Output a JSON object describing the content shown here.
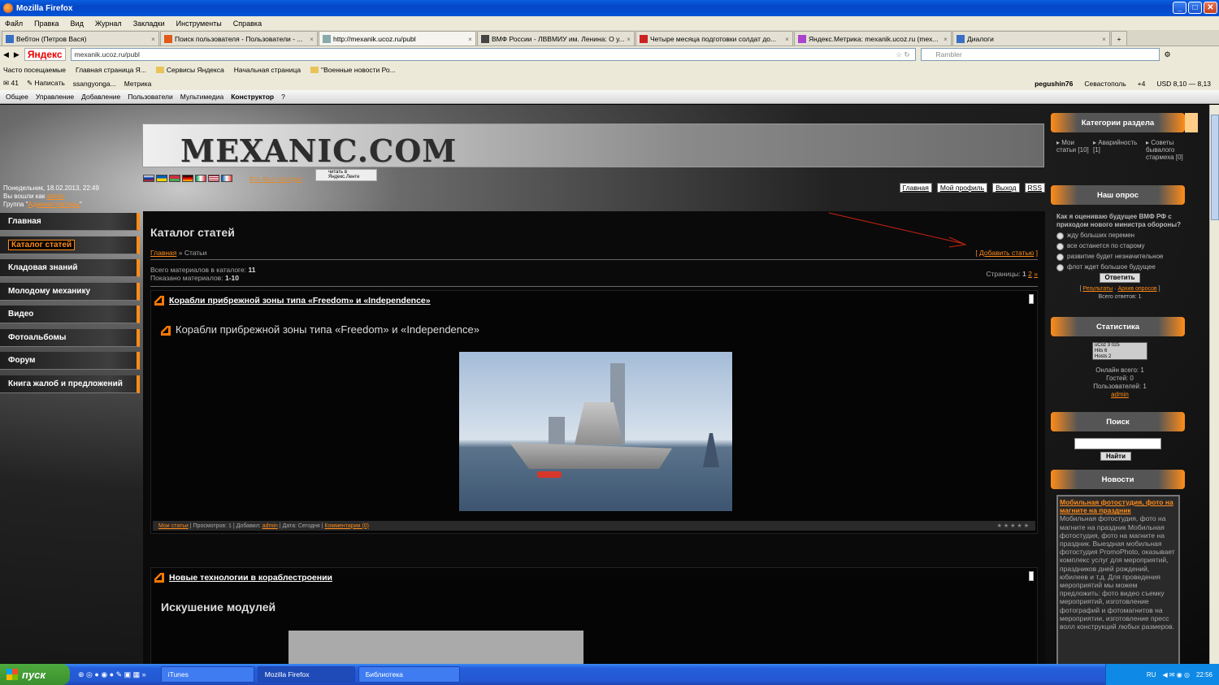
{
  "window": {
    "title": "Mozilla Firefox"
  },
  "menu": [
    "Файл",
    "Правка",
    "Вид",
    "Журнал",
    "Закладки",
    "Инструменты",
    "Справка"
  ],
  "tabs": [
    {
      "label": "Вебтон (Петров Вася)",
      "active": false
    },
    {
      "label": "Поиск пользователя - Пользователи - ...",
      "active": false
    },
    {
      "label": "http://mexanik.ucoz.ru/publ",
      "active": true
    },
    {
      "label": "ВМФ России - ЛВВМИУ им. Ленина: О у...",
      "active": false
    },
    {
      "label": "Четыре месяца подготовки солдат до...",
      "active": false
    },
    {
      "label": "Яндекс.Метрика: mexanik.ucoz.ru (mex...",
      "active": false
    },
    {
      "label": "Диалоги",
      "active": false
    }
  ],
  "nav": {
    "yandex": "Яндекс",
    "url": "mexanik.ucoz.ru/publ",
    "search_placeholder": "Rambler"
  },
  "bookmarks": [
    "Часто посещаемые",
    "Главная страница Я...",
    "Сервисы Яндекса",
    "Начальная страница",
    "\"Военные новости Ро..."
  ],
  "yabar": {
    "mail": "41",
    "write": "Написать",
    "user_short": "ssangyonga...",
    "metrika": "Метрика",
    "username": "pegushin76",
    "city": "Севастополь",
    "temp": "+4",
    "usd": "USD 8,10 — 8,13"
  },
  "ucoz_menu": [
    "Общее",
    "Управление",
    "Добавление",
    "Пользователи",
    "Мультимедиа",
    "Конструктор",
    "?"
  ],
  "site": {
    "logo": "MEXANIC.COM",
    "kto": "Кто был сегодня",
    "yalenta": "читать в Яндекс.Ленте",
    "date": "Понедельник, 18.02.2013, 22:49",
    "logged_as": "Вы вошли как",
    "user": "admin",
    "group_label": "Группа",
    "group": "Администраторы",
    "toplinks": [
      "Главная",
      "Мой профиль",
      "Выход",
      "RSS"
    ],
    "left_menu": [
      "Главная",
      "Каталог статей",
      "Кладовая знаний",
      "Молодому механику",
      "Видео",
      "Фотоальбомы",
      "Форум",
      "Книга жалоб и предложений"
    ]
  },
  "content": {
    "title": "Каталог статей",
    "crumb_home": "Главная",
    "crumb_sep": " » ",
    "crumb_current": "Статьи",
    "add": "Добавить статью",
    "total_label": "Всего материалов в каталоге:",
    "total": "11",
    "shown_label": "Показано материалов:",
    "shown": "1-10",
    "pages_label": "Страницы:",
    "pages": [
      "1",
      "2",
      "»"
    ],
    "entries": [
      {
        "title": "Корабли прибрежной зоны типа «Freedom» и «Independence»",
        "big": "Корабли прибрежной зоны типа «Freedom» и «Independence»",
        "footer_cat": "Мои статьи",
        "footer_views": "Просмотров: 1",
        "footer_added": "Добавил:",
        "footer_user": "admin",
        "footer_date": "Дата: Сегодня",
        "footer_comments": "Комментарии (0)"
      },
      {
        "title": "Новые технологии в кораблестроении",
        "big": "Искушение модулей"
      }
    ]
  },
  "sidebar": {
    "categories_title": "Категории раздела",
    "categories": [
      {
        "name": "Мои статьи",
        "count": "[10]"
      },
      {
        "name": "Аварийность",
        "count": "[1]"
      },
      {
        "name": "Советы бывалого стармеха",
        "count": "[0]"
      }
    ],
    "poll_title": "Наш опрос",
    "poll_q": "Как я оцениваю будущее ВМФ РФ с приходом нового министра обороны?",
    "poll_opts": [
      "жду больших перемен",
      "все останется по старому",
      "развитие будет незначительное",
      "флот ждет большое будущее"
    ],
    "poll_btn": "Ответить",
    "poll_results": "Результаты",
    "poll_archive": "Архив опросов",
    "poll_total": "Всего ответов: 1",
    "stats_title": "Статистика",
    "counter": [
      "uCoz 3 025",
      "Hits 6",
      "Hosts 2"
    ],
    "online": "Онлайн всего: 1",
    "guests": "Гостей: 0",
    "users": "Пользователей: 1",
    "online_user": "admin",
    "search_title": "Поиск",
    "search_btn": "Найти",
    "news_title": "Новости",
    "news_head": "Мобильная фотостудия, фото на магните на праздник",
    "news_body": "Мобильная фотостудия, фото на магните на праздник Мобильная фотостудия, фото на магните на праздник. Выездная мобильная фотостудия PromoPhoto, оказывает комплекс услуг для мероприятий, праздников дней рождений, юбилеев и т.д. Для проведения мероприятий мы можем предложить: фото видео съемку мероприятий, изготовление фотографий и фотомагнитов на мероприятии, изготовление пресс волл конструкций любых размеров."
  },
  "taskbar": {
    "start": "пуск",
    "items": [
      "iTunes",
      "Mozilla Firefox",
      "Библиотека"
    ],
    "lang": "RU",
    "time": "22:56"
  }
}
